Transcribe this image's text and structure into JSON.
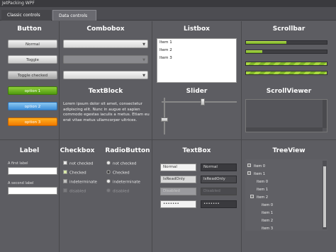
{
  "window": {
    "title": "JetPacking WPF"
  },
  "tabs": [
    {
      "label": "Classic controls"
    },
    {
      "label": "Data controls"
    }
  ],
  "headings": {
    "button": "Button",
    "combobox": "Combobox",
    "listbox": "Listbox",
    "scrollbar": "Scrollbar",
    "textblock": "TextBlock",
    "slider": "Slider",
    "scrollviewer": "ScrollViewer",
    "label": "Label",
    "checkbox": "Checkbox",
    "radiobutton": "RadioButton",
    "textbox": "TextBox",
    "treeview": "TreeView"
  },
  "buttons": {
    "normal": "Normal",
    "toggle": "Toggle",
    "toggle_checked": "Toggle checked",
    "option1": "option 1",
    "option2": "option 2",
    "option3": "option 3"
  },
  "listbox": {
    "items": [
      "Item 1",
      "Item 2",
      "Item 3"
    ]
  },
  "textblock": {
    "text": "Lorem ipsum dolor sit amet, consectetur adipiscing elit. Nunc in augue et sapien commodo egestas iaculis a metus. Etiam eu erat vitae metus ullamcorper ultrices."
  },
  "scrollbars": {
    "levels": [
      0.5,
      0.2,
      1.0,
      1.0
    ]
  },
  "slider": {
    "horizontal_value": 0.55,
    "vertical_value": 0.6
  },
  "labels": {
    "first": "A first label",
    "second": "A second label"
  },
  "checkboxes": [
    {
      "label": "not checked"
    },
    {
      "label": "Checked"
    },
    {
      "label": "indeterminate"
    },
    {
      "label": "disabled"
    }
  ],
  "radios": [
    {
      "label": "not checked"
    },
    {
      "label": "Checked"
    },
    {
      "label": "indeterminate"
    },
    {
      "label": "disabled"
    }
  ],
  "textboxes": {
    "normal": "Normal",
    "normal_dark": "Normal",
    "readonly": "IsReadOnly",
    "readonly_dark": "IsReadOnly",
    "disabled": "Disabled",
    "disabled_dark": "Disabled",
    "password": "•••••••",
    "password_dark": "•••••••"
  },
  "tree": {
    "items": [
      "item 0",
      "item 1",
      "item 0",
      "item 1",
      "item 2",
      "item 0",
      "item 1",
      "item 2",
      "item 3"
    ]
  },
  "colors": {
    "accent_green": "#6fa820",
    "accent_blue": "#3d8ed8",
    "accent_orange": "#f07a00"
  }
}
